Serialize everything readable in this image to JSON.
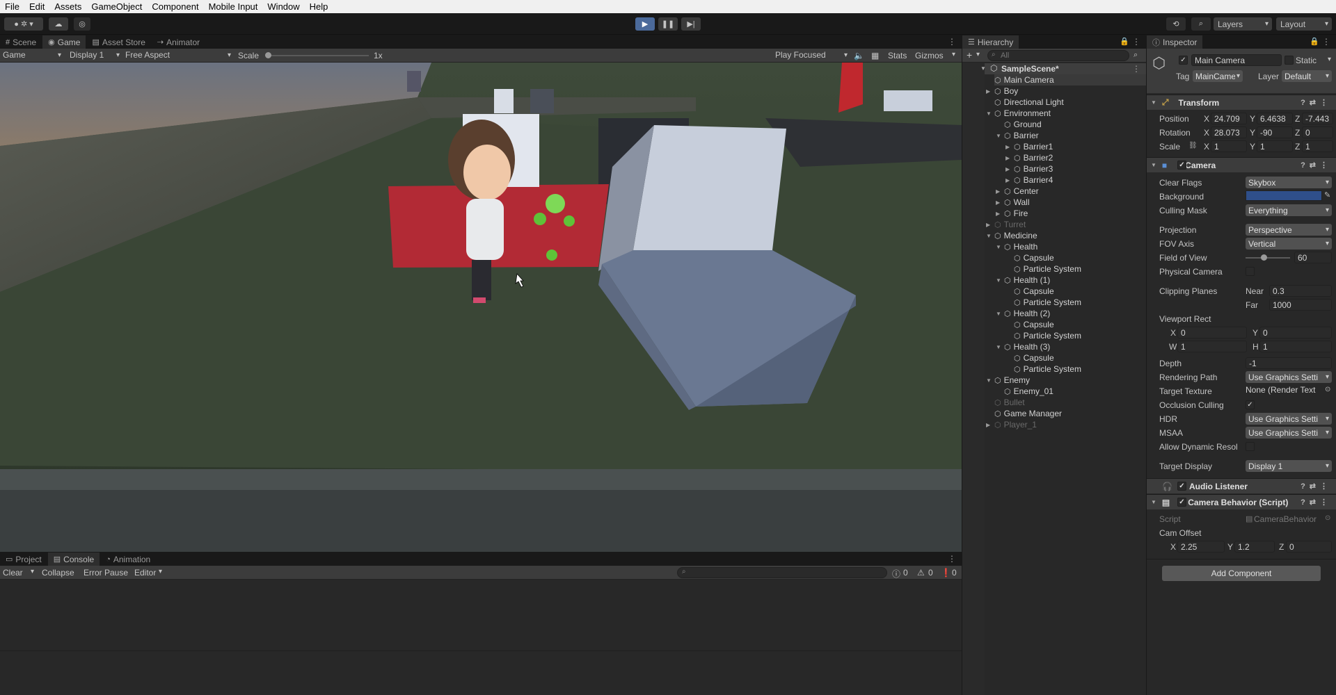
{
  "menu": [
    "File",
    "Edit",
    "Assets",
    "GameObject",
    "Component",
    "Mobile Input",
    "Window",
    "Help"
  ],
  "toolbar": {
    "layers": "Layers",
    "layout": "Layout"
  },
  "game_panel": {
    "tabs": [
      "Scene",
      "Game",
      "Asset Store",
      "Animator"
    ],
    "game_dropdown": "Game",
    "display": "Display 1",
    "aspect": "Free Aspect",
    "scale_label": "Scale",
    "scale_value": "1x",
    "play_focused": "Play Focused",
    "stats": "Stats",
    "gizmos": "Gizmos"
  },
  "console_panel": {
    "tabs": [
      "Project",
      "Console",
      "Animation"
    ],
    "clear": "Clear",
    "collapse": "Collapse",
    "error_pause": "Error Pause",
    "editor": "Editor",
    "log_count": "0",
    "warn_count": "0",
    "error_count": "0"
  },
  "hierarchy": {
    "title": "Hierarchy",
    "search_placeholder": "All",
    "scene": "SampleScene*",
    "items": [
      {
        "label": "Main Camera",
        "depth": 1,
        "arrow": false,
        "dim": false,
        "selected": true
      },
      {
        "label": "Boy",
        "depth": 1,
        "arrow": "right",
        "dim": false
      },
      {
        "label": "Directional Light",
        "depth": 1,
        "arrow": false,
        "dim": false
      },
      {
        "label": "Environment",
        "depth": 1,
        "arrow": "down",
        "dim": false
      },
      {
        "label": "Ground",
        "depth": 2,
        "arrow": false,
        "dim": false
      },
      {
        "label": "Barrier",
        "depth": 2,
        "arrow": "down",
        "dim": false
      },
      {
        "label": "Barrier1",
        "depth": 3,
        "arrow": "right",
        "dim": false
      },
      {
        "label": "Barrier2",
        "depth": 3,
        "arrow": "right",
        "dim": false
      },
      {
        "label": "Barrier3",
        "depth": 3,
        "arrow": "right",
        "dim": false
      },
      {
        "label": "Barrier4",
        "depth": 3,
        "arrow": "right",
        "dim": false
      },
      {
        "label": "Center",
        "depth": 2,
        "arrow": "right",
        "dim": false
      },
      {
        "label": "Wall",
        "depth": 2,
        "arrow": "right",
        "dim": false
      },
      {
        "label": "Fire",
        "depth": 2,
        "arrow": "right",
        "dim": false
      },
      {
        "label": "Turret",
        "depth": 1,
        "arrow": "right",
        "dim": true
      },
      {
        "label": "Medicine",
        "depth": 1,
        "arrow": "down",
        "dim": false
      },
      {
        "label": "Health",
        "depth": 2,
        "arrow": "down",
        "dim": false
      },
      {
        "label": "Capsule",
        "depth": 3,
        "arrow": false,
        "dim": false
      },
      {
        "label": "Particle System",
        "depth": 3,
        "arrow": false,
        "dim": false
      },
      {
        "label": "Health (1)",
        "depth": 2,
        "arrow": "down",
        "dim": false
      },
      {
        "label": "Capsule",
        "depth": 3,
        "arrow": false,
        "dim": false
      },
      {
        "label": "Particle System",
        "depth": 3,
        "arrow": false,
        "dim": false
      },
      {
        "label": "Health (2)",
        "depth": 2,
        "arrow": "down",
        "dim": false
      },
      {
        "label": "Capsule",
        "depth": 3,
        "arrow": false,
        "dim": false
      },
      {
        "label": "Particle System",
        "depth": 3,
        "arrow": false,
        "dim": false
      },
      {
        "label": "Health (3)",
        "depth": 2,
        "arrow": "down",
        "dim": false
      },
      {
        "label": "Capsule",
        "depth": 3,
        "arrow": false,
        "dim": false
      },
      {
        "label": "Particle System",
        "depth": 3,
        "arrow": false,
        "dim": false
      },
      {
        "label": "Enemy",
        "depth": 1,
        "arrow": "down",
        "dim": false
      },
      {
        "label": "Enemy_01",
        "depth": 2,
        "arrow": false,
        "dim": false
      },
      {
        "label": "Bullet",
        "depth": 1,
        "arrow": false,
        "dim": true
      },
      {
        "label": "Game Manager",
        "depth": 1,
        "arrow": false,
        "dim": false
      },
      {
        "label": "Player_1",
        "depth": 1,
        "arrow": "right",
        "dim": true
      }
    ]
  },
  "inspector": {
    "title": "Inspector",
    "object_name": "Main Camera",
    "static": "Static",
    "tag_label": "Tag",
    "tag": "MainCame",
    "layer_label": "Layer",
    "layer": "Default",
    "transform": {
      "title": "Transform",
      "position_label": "Position",
      "rotation_label": "Rotation",
      "scale_label": "Scale",
      "position": {
        "x": "24.709",
        "y": "6.4638",
        "z": "-7.443"
      },
      "rotation": {
        "x": "28.073",
        "y": "-90",
        "z": "0"
      },
      "scale": {
        "x": "1",
        "y": "1",
        "z": "1"
      }
    },
    "camera": {
      "title": "Camera",
      "clear_flags_label": "Clear Flags",
      "clear_flags": "Skybox",
      "background_label": "Background",
      "background_color": "#2f4f8a",
      "culling_mask_label": "Culling Mask",
      "culling_mask": "Everything",
      "projection_label": "Projection",
      "projection": "Perspective",
      "fov_axis_label": "FOV Axis",
      "fov_axis": "Vertical",
      "fov_label": "Field of View",
      "fov": "60",
      "physical_label": "Physical Camera",
      "clipping_label": "Clipping Planes",
      "near_label": "Near",
      "near": "0.3",
      "far_label": "Far",
      "far": "1000",
      "viewport_label": "Viewport Rect",
      "vx": "0",
      "vy": "0",
      "vw": "1",
      "vh": "1",
      "depth_label": "Depth",
      "depth": "-1",
      "rendering_path_label": "Rendering Path",
      "rendering_path": "Use Graphics Setti",
      "target_texture_label": "Target Texture",
      "target_texture": "None (Render Text",
      "occlusion_label": "Occlusion Culling",
      "hdr_label": "HDR",
      "hdr": "Use Graphics Setti",
      "msaa_label": "MSAA",
      "msaa": "Use Graphics Setti",
      "dynamic_label": "Allow Dynamic Resol",
      "target_display_label": "Target Display",
      "target_display": "Display 1"
    },
    "audio_listener": "Audio Listener",
    "camera_behavior": {
      "title": "Camera Behavior (Script)",
      "script_label": "Script",
      "script": "CameraBehavior",
      "cam_offset_label": "Cam Offset",
      "x": "2.25",
      "y": "1.2",
      "z": "0"
    },
    "add_component": "Add Component"
  }
}
